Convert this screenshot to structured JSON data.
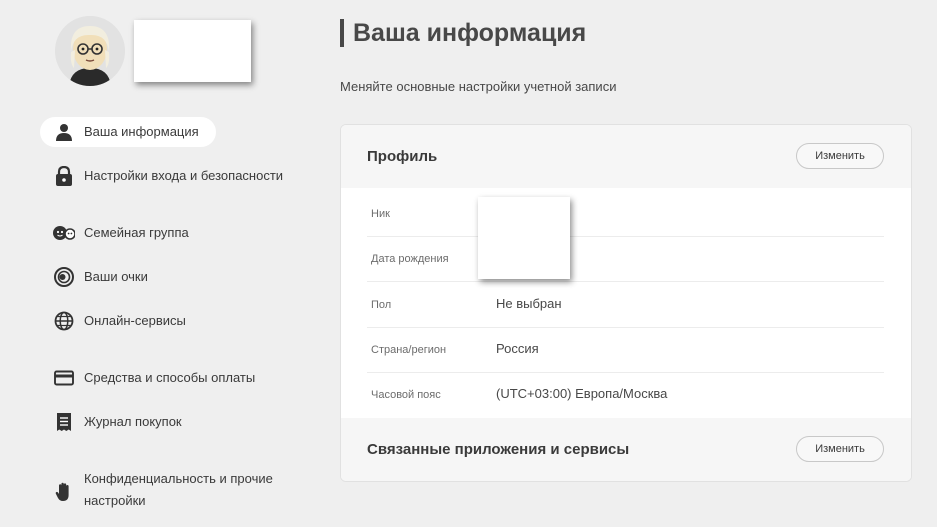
{
  "sidebar": {
    "items": [
      {
        "label": "Ваша информация",
        "icon": "person-icon"
      },
      {
        "label": "Настройки входа и безопасности",
        "icon": "lock-icon"
      },
      {
        "label": "Семейная группа",
        "icon": "family-icon"
      },
      {
        "label": "Ваши очки",
        "icon": "points-icon"
      },
      {
        "label": "Онлайн-сервисы",
        "icon": "globe-icon"
      },
      {
        "label": "Средства и способы оплаты",
        "icon": "credit-card-icon"
      },
      {
        "label": "Журнал покупок",
        "icon": "receipt-icon"
      },
      {
        "label": "Конфиденциальность и прочие настройки",
        "icon": "hand-icon"
      }
    ]
  },
  "main": {
    "title": "Ваша информация",
    "subtitle": "Меняйте основные настройки учетной записи",
    "profile": {
      "title": "Профиль",
      "edit_label": "Изменить",
      "rows": [
        {
          "label": "Ник",
          "value": ""
        },
        {
          "label": "Дата рождения",
          "value": ""
        },
        {
          "label": "Пол",
          "value": "Не выбран"
        },
        {
          "label": "Страна/регион",
          "value": "Россия"
        },
        {
          "label": "Часовой пояс",
          "value": "(UTC+03:00) Европа/Москва"
        }
      ]
    },
    "linked": {
      "title": "Связанные приложения и сервисы",
      "edit_label": "Изменить"
    }
  },
  "colors": {
    "background": "#efefef",
    "card": "#ffffff",
    "card_header": "#f6f6f6",
    "text": "#484848"
  }
}
